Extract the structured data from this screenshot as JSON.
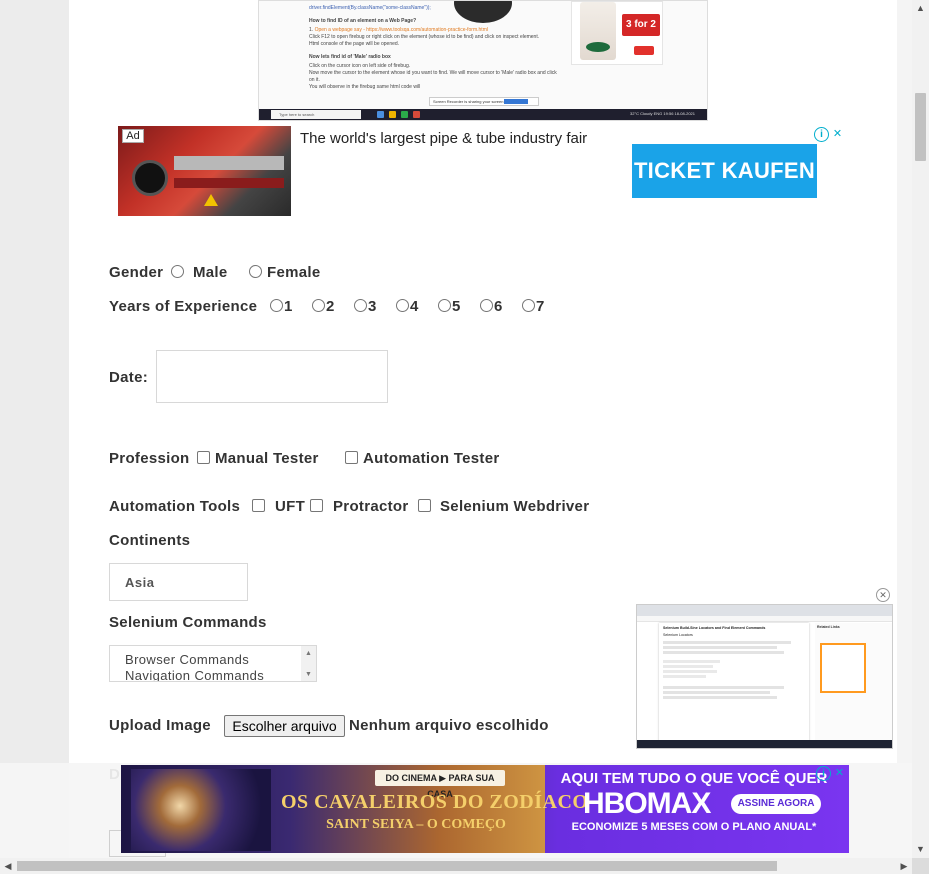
{
  "top_screenshot": {
    "doc_lines": [
      "driver.findElement(By.className(\"some-className\"));",
      "How to find ID of an element on a Web Page?",
      "Open a webpage say - https://www.toolsqa.com/automation-practice-form.html",
      "Click F12 to open firebug or right click on the element (whose id to be find) and click on inspect element.",
      "Html console of the page will be opened.",
      "Now lets find id of 'Male' radio box",
      "Click on the cursor icon on left side of firebug.",
      "Now move the cursor to the element whose id you want to find. We will move cursor to 'Male' radio box and click on it.",
      "You will observe in the firebug same html code will"
    ],
    "share_text": "Screen Recorder is sharing your screen",
    "share_button": "Stop sharing",
    "share_hide": "Hide",
    "promo_deal": "3 for 2",
    "taskbar_search": "Type here to search",
    "taskbar_tray": "32°C Cloudy  ENG  19:56 18-08-2021"
  },
  "ad_pipe": {
    "badge": "Ad",
    "headline": "The world's largest pipe & tube industry fair",
    "cta": "TICKET KAUFEN"
  },
  "form": {
    "gender": {
      "label": "Gender",
      "options": [
        "Male",
        "Female"
      ]
    },
    "experience": {
      "label": "Years of Experience",
      "options": [
        "1",
        "2",
        "3",
        "4",
        "5",
        "6",
        "7"
      ]
    },
    "date": {
      "label": "Date:",
      "value": ""
    },
    "profession": {
      "label": "Profession",
      "options": [
        "Manual Tester",
        "Automation Tester"
      ]
    },
    "automation_tools": {
      "label": "Automation Tools",
      "options": [
        "UFT",
        "Protractor",
        "Selenium Webdriver"
      ]
    },
    "continents": {
      "label": "Continents",
      "selected": "Asia"
    },
    "selenium_commands": {
      "label": "Selenium Commands",
      "options": [
        "Browser Commands",
        "Navigation Commands"
      ]
    },
    "upload": {
      "label": "Upload Image",
      "button": "Escolher arquivo",
      "status": "Nenhum arquivo escolhido"
    },
    "partial_label": "D"
  },
  "ad_video": {
    "doc_title": "Selenium Build-Sine Locators and Find Element Commands",
    "doc_section": "Selenium Locators",
    "sidebar_title": "Related Links"
  },
  "ad_hbo": {
    "cinema_tag": "DO CINEMA ▶ PARA SUA CASA",
    "movie_title": "OS CAVALEIROS DO ZODÍACO",
    "movie_subtitle": "SAINT SEIYA – O COMEÇO",
    "tagline": "AQUI TEM TUDO O QUE VOCÊ QUER",
    "brand": "HBOMAX",
    "cta": "ASSINE AGORA",
    "offer": "ECONOMIZE 5 MESES COM O PLANO ANUAL*"
  },
  "colors": {
    "ticket_button": "#1aa3e8",
    "adchoice": "#00aecd",
    "hbo_purple": "#6a2ee0",
    "text": "#333333"
  },
  "icons": {
    "adchoice_info": "info-icon",
    "adchoice_close": "close-icon",
    "scroll_up": "arrow-up-icon",
    "scroll_down": "arrow-down-icon",
    "scroll_left": "arrow-left-icon",
    "scroll_right": "arrow-right-icon"
  }
}
